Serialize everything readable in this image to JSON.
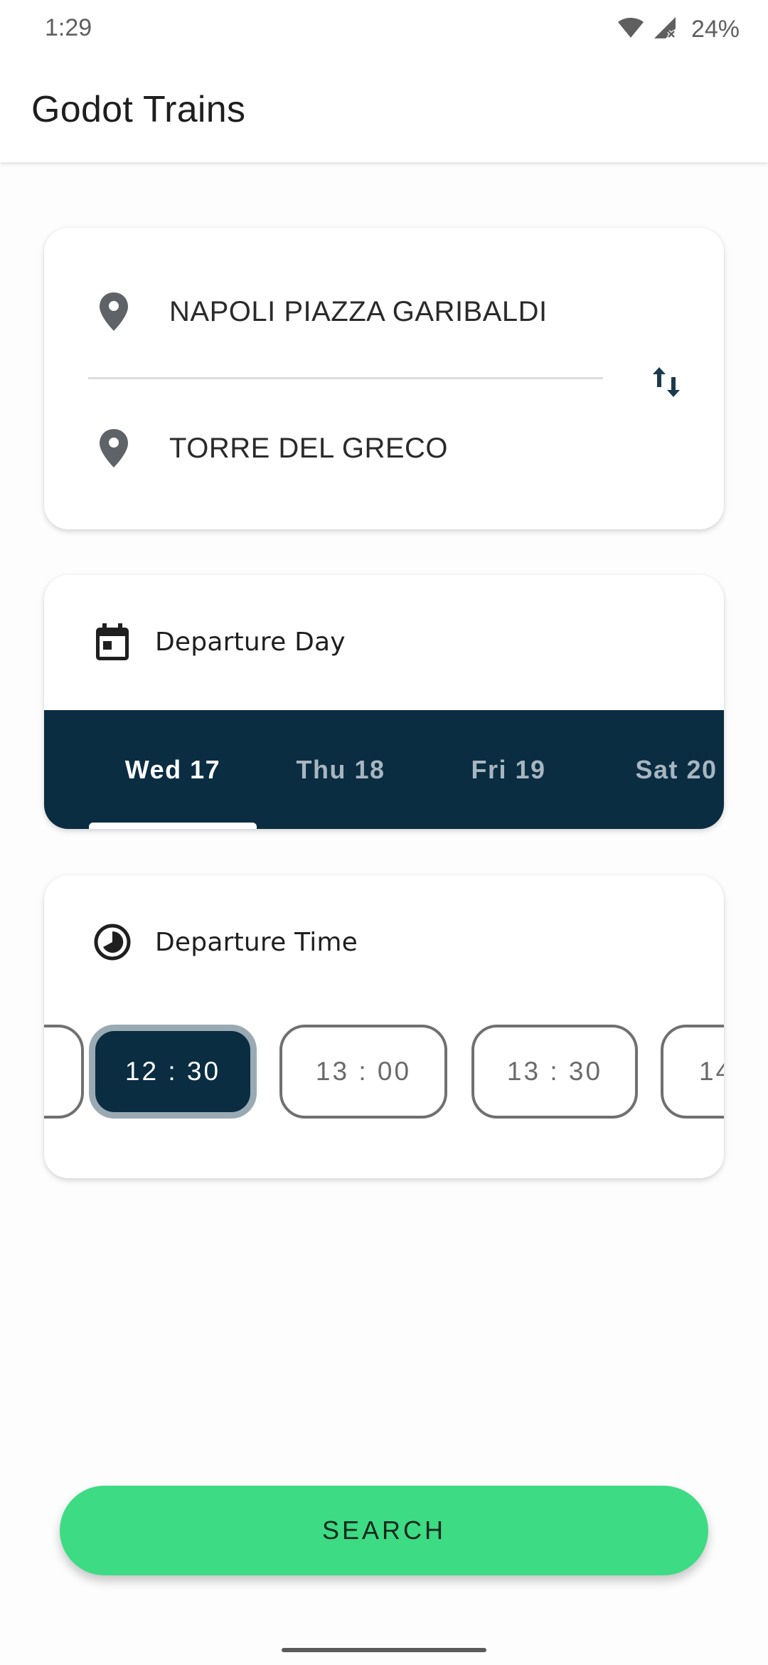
{
  "status_bar": {
    "time": "1:29",
    "battery": "24%",
    "icons": [
      "wifi-icon",
      "cellular-no-signal-icon"
    ]
  },
  "app_bar": {
    "title": "Godot Trains"
  },
  "route": {
    "from_station": "NAPOLI PIAZZA GARIBALDI",
    "to_station": "TORRE DEL GRECO",
    "icons": [
      "location-pin-icon",
      "swap-vertical-icon"
    ]
  },
  "departure_day": {
    "label": "Departure Day",
    "icon": "calendar-icon",
    "tabs": [
      {
        "label": "Wed 17",
        "selected": true
      },
      {
        "label": "Thu 18",
        "selected": false
      },
      {
        "label": "Fri 19",
        "selected": false
      },
      {
        "label": "Sat 20",
        "selected": false
      }
    ]
  },
  "departure_time": {
    "label": "Departure Time",
    "icon": "clock-icon",
    "slots": [
      {
        "label": "",
        "selected": false
      },
      {
        "label": "12 : 30",
        "selected": true
      },
      {
        "label": "13 : 00",
        "selected": false
      },
      {
        "label": "13 : 30",
        "selected": false
      },
      {
        "label": "14",
        "selected": false
      }
    ]
  },
  "search_button": {
    "label": "SEARCH"
  },
  "colors": {
    "primary_dark": "#0a2d42",
    "accent_green": "#3ddb84",
    "icon_gray": "#5f6368"
  }
}
